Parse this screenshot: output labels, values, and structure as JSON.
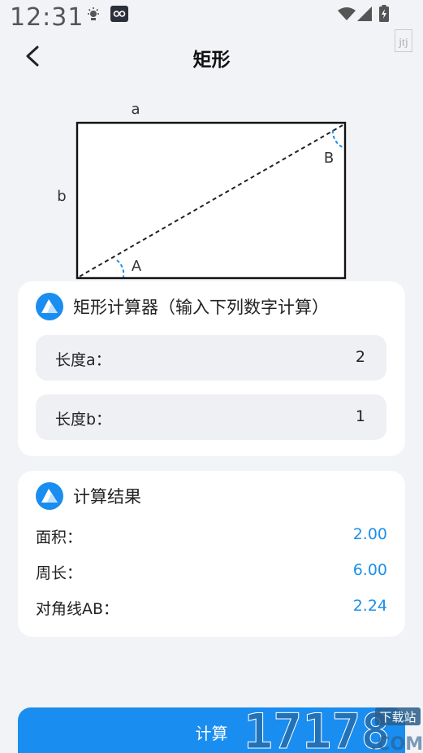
{
  "status_bar": {
    "time": "12:31"
  },
  "header": {
    "title": "矩形"
  },
  "diagram": {
    "label_a": "a",
    "label_b": "b",
    "angle_a": "A",
    "angle_b": "B"
  },
  "calculator": {
    "title": "矩形计算器（输入下列数字计算）",
    "fields": [
      {
        "label": "长度a：",
        "value": "2"
      },
      {
        "label": "长度b：",
        "value": "1"
      }
    ]
  },
  "results": {
    "title": "计算结果",
    "rows": [
      {
        "label": "面积：",
        "value": "2.00"
      },
      {
        "label": "周长：",
        "value": "6.00"
      },
      {
        "label": "对角线AB：",
        "value": "2.24"
      }
    ]
  },
  "action": {
    "calculate_label": "计算"
  },
  "watermark": {
    "brand": "17178",
    "suffix": ".COM",
    "tag": "下载站"
  },
  "colors": {
    "accent": "#1a8df0",
    "result": "#1d8fe8",
    "background": "#f2f3f7"
  }
}
